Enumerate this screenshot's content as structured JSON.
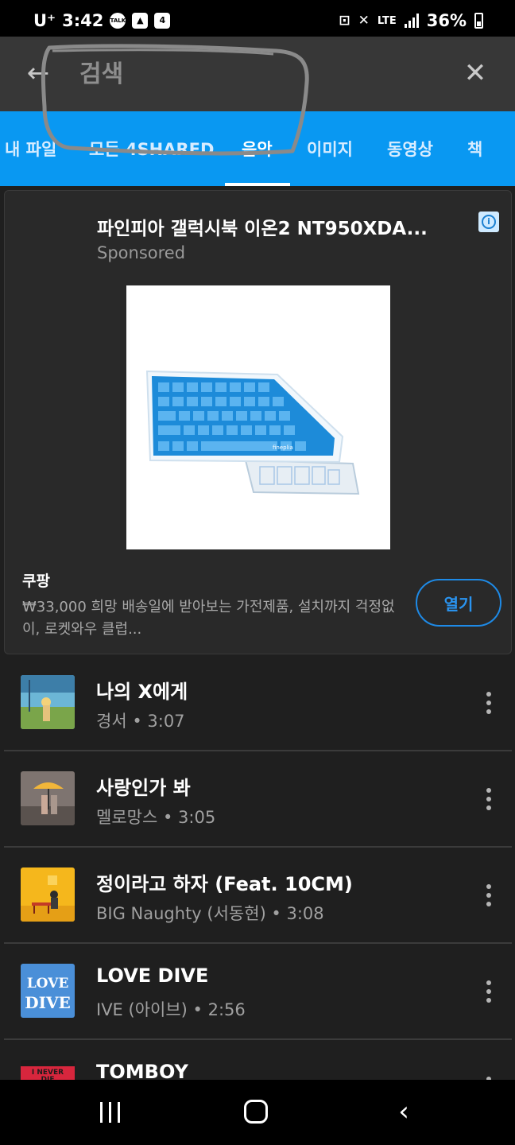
{
  "status_bar": {
    "carrier": "U⁺",
    "time": "3:42",
    "talk_label": "TALK",
    "notification_count": "4",
    "network": "LTE",
    "battery": "36%"
  },
  "search": {
    "placeholder": "검색"
  },
  "tabs": [
    {
      "label": "내 파일"
    },
    {
      "label": "모든 4SHARED"
    },
    {
      "label": "음악",
      "active": true
    },
    {
      "label": "이미지"
    },
    {
      "label": "동영상"
    },
    {
      "label": "책"
    }
  ],
  "ad": {
    "title": "파인피아 갤럭시북 이온2 NT950XDA...",
    "sponsored": "Sponsored",
    "brand": "쿠팡",
    "description": "₩33,000 희망 배송일에 받아보는 가전제품, 설치까지 걱정없이, 로켓와우 클럽...",
    "open_label": "열기",
    "info_icon": "info-icon",
    "image_brand_text": "fineplia",
    "accent_color": "#1e8ae6"
  },
  "songs": [
    {
      "title": "나의 X에게",
      "meta": "경서 • 3:07"
    },
    {
      "title": "사랑인가 봐",
      "meta": "멜로망스 • 3:05"
    },
    {
      "title": "정이라고 하자 (Feat. 10CM)",
      "meta": "BIG Naughty (서동현) • 3:08"
    },
    {
      "title": "LOVE DIVE",
      "meta": "IVE (아이브) • 2:56"
    },
    {
      "title": "TOMBOY",
      "meta": ""
    }
  ],
  "album_art_text": {
    "love_dive": "LOVE DIVE",
    "tomboy": "I NEVER DIE"
  },
  "colors": {
    "tab_bar": "#0998f2",
    "header": "#373737",
    "background": "#1f1f1f",
    "card": "#292929"
  }
}
